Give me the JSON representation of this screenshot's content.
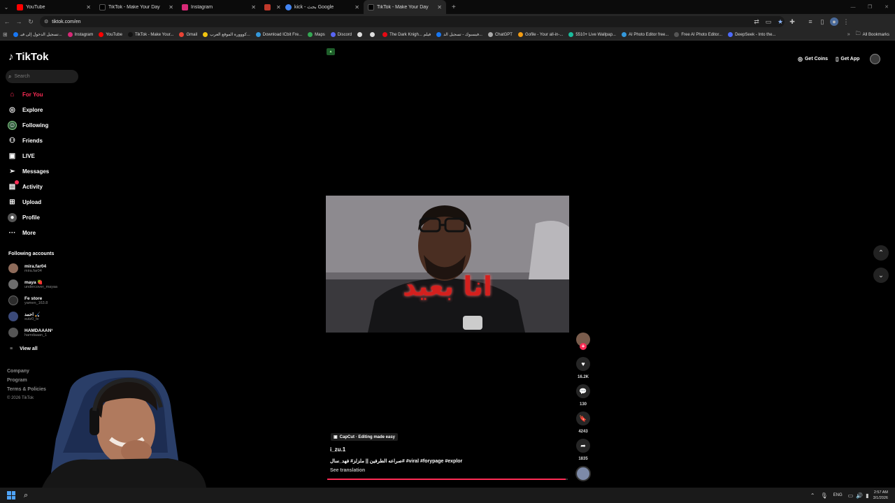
{
  "browser": {
    "tabs": [
      {
        "title": "YouTube",
        "color": "#ff0000"
      },
      {
        "title": "TikTok - Make Your Day",
        "color": "#000000"
      },
      {
        "title": "Instagram",
        "color": "#d62976"
      },
      {
        "title": "",
        "color": "#c0392b"
      },
      {
        "title": "kick - بحث Google",
        "color": "#4285f4"
      },
      {
        "title": "TikTok - Make Your Day",
        "color": "#000000"
      }
    ],
    "new_tab": "+",
    "url": "tiktok.com/en",
    "bookmarks": [
      {
        "label": "تسجيل الدخول إلى فيـ...",
        "color": "#1877f2"
      },
      {
        "label": "Instagram",
        "color": "#d62976"
      },
      {
        "label": "YouTube",
        "color": "#ff0000"
      },
      {
        "label": "TikTok - Make Your...",
        "color": "#111111"
      },
      {
        "label": "Gmail",
        "color": "#ea4335"
      },
      {
        "label": "كووورة الموقع العرب...",
        "color": "#f1c40f"
      },
      {
        "label": "Download ICbit Fre...",
        "color": "#3498db"
      },
      {
        "label": "Maps",
        "color": "#34a853"
      },
      {
        "label": "Discord",
        "color": "#5865f2"
      },
      {
        "label": "",
        "color": "#dddddd"
      },
      {
        "label": "",
        "color": "#dddddd"
      },
      {
        "label": "The Dark Knigh... فيلم",
        "color": "#e50914"
      },
      {
        "label": "فيسبوك - تسجيل الد...",
        "color": "#1877f2"
      },
      {
        "label": "ChatGPT",
        "color": "#aaaaaa"
      },
      {
        "label": "Gofile - Your all-in-...",
        "color": "#f39c12"
      },
      {
        "label": "5510+ Live Wallpap...",
        "color": "#1abc9c"
      },
      {
        "label": "AI Photo Editor free...",
        "color": "#3498db"
      },
      {
        "label": "Free AI Photo Editor...",
        "color": "#555555"
      },
      {
        "label": "DeepSeek - Into the...",
        "color": "#4d6bfe"
      }
    ],
    "all_bookmarks": "All Bookmarks"
  },
  "sidebar": {
    "logo": "TikTok",
    "search_placeholder": "Search",
    "nav": [
      {
        "label": "For You",
        "icon": "home-icon"
      },
      {
        "label": "Explore",
        "icon": "compass-icon"
      },
      {
        "label": "Following",
        "icon": "following-icon"
      },
      {
        "label": "Friends",
        "icon": "friends-icon"
      },
      {
        "label": "LIVE",
        "icon": "live-icon"
      },
      {
        "label": "Messages",
        "icon": "messages-icon"
      },
      {
        "label": "Activity",
        "icon": "activity-icon"
      },
      {
        "label": "Upload",
        "icon": "upload-icon"
      },
      {
        "label": "Profile",
        "icon": "profile-icon"
      },
      {
        "label": "More",
        "icon": "more-icon"
      }
    ],
    "following_title": "Following accounts",
    "accounts": [
      {
        "name": "mira.far04",
        "handle": "mira.far04",
        "color": "#8e6b5a"
      },
      {
        "name": "maya 🍓",
        "handle": "undercover_mayaa",
        "color": "#6d6d6d"
      },
      {
        "name": "Fe store",
        "handle": "yamen_163.8",
        "color": "#2c2c2c"
      },
      {
        "name": "احمد 🏑",
        "handle": "sutz0_tv",
        "color": "#3b4a7a"
      },
      {
        "name": "HAMDAAAN¹",
        "handle": "hamdaaan_1",
        "color": "#555555"
      }
    ],
    "view_all": "View all",
    "footer": [
      "Company",
      "Program",
      "Terms & Policies"
    ],
    "copyright": "© 2026 TikTok"
  },
  "header": {
    "get_coins": "Get Coins",
    "get_app": "Get App"
  },
  "video": {
    "caption_overlay": "انا بعيد",
    "sponsor": "CapCut · Editing made easy",
    "author": "i_zu.1",
    "description": "صراعه الطرفين || ملزلز# فهد_سال# #viral #forypage #explor",
    "see_translation": "See translation",
    "progress": 0.99
  },
  "actions": {
    "likes": "16.2K",
    "comments": "130",
    "bookmarks": "4243",
    "shares": "1835"
  },
  "taskbar": {
    "lang": "ENG",
    "time": "2:57 AM",
    "date": "3/1/2026"
  }
}
